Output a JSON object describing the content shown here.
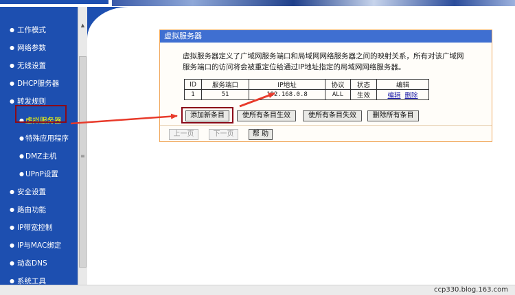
{
  "sidebar": {
    "items": [
      {
        "label": "工作模式",
        "level": "top",
        "active": false
      },
      {
        "label": "网络参数",
        "level": "top",
        "active": false
      },
      {
        "label": "无线设置",
        "level": "top",
        "active": false
      },
      {
        "label": "DHCP服务器",
        "level": "top",
        "active": false
      },
      {
        "label": "转发规则",
        "level": "top",
        "active": false
      },
      {
        "label": "虚拟服务器",
        "level": "sub",
        "active": true
      },
      {
        "label": "特殊应用程序",
        "level": "sub",
        "active": false
      },
      {
        "label": "DMZ主机",
        "level": "sub",
        "active": false
      },
      {
        "label": "UPnP设置",
        "level": "sub",
        "active": false
      },
      {
        "label": "安全设置",
        "level": "top",
        "active": false
      },
      {
        "label": "路由功能",
        "level": "top",
        "active": false
      },
      {
        "label": "IP带宽控制",
        "level": "top",
        "active": false
      },
      {
        "label": "IP与MAC绑定",
        "level": "top",
        "active": false
      },
      {
        "label": "动态DNS",
        "level": "top",
        "active": false
      },
      {
        "label": "系统工具",
        "level": "top",
        "active": false
      }
    ]
  },
  "panel": {
    "title": "虚拟服务器",
    "description_line1": "虚拟服务器定义了广域网服务端口和局域网网络服务器之间的映射关系，所有对该广域网",
    "description_line2": "服务端口的访问将会被重定位给通过IP地址指定的局域网网络服务器。"
  },
  "table": {
    "headers": {
      "id": "ID",
      "port": "服务端口",
      "ip": "IP地址",
      "protocol": "协议",
      "status": "状态",
      "edit": "编辑"
    },
    "rows": [
      {
        "id": "1",
        "port": "51",
        "ip": "192.168.0.8",
        "protocol": "ALL",
        "status": "生效",
        "edit_label": "编辑",
        "delete_label": "删除"
      }
    ]
  },
  "buttons": {
    "add": "添加新条目",
    "enable_all": "使所有条目生效",
    "disable_all": "使所有条目失效",
    "delete_all": "删除所有条目",
    "prev": "上一页",
    "next": "下一页",
    "help": "帮 助"
  },
  "scrollbar": {
    "up_icon": "▲",
    "down_icon": "▼",
    "grip": "≡"
  },
  "watermark": "ccp330.blog.163.com",
  "colors": {
    "sidebar": "#1d4fb0",
    "panel_title": "#3f6fd1",
    "panel_border": "#f0a75a",
    "highlight_box": "#8b0a18",
    "arrow": "#e83a2a",
    "active_text": "#ffff00"
  }
}
